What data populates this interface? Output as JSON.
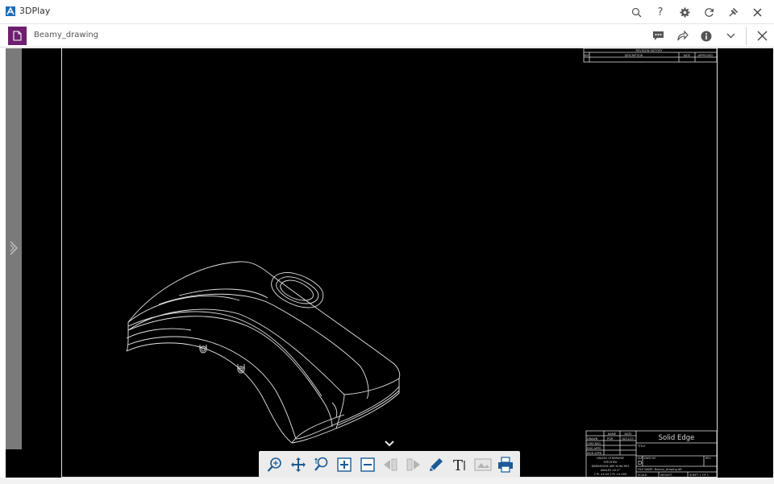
{
  "app": {
    "title": "3DPlay",
    "icons": [
      "search-icon",
      "help-icon",
      "settings-icon",
      "refresh-icon",
      "pin-icon",
      "close-icon"
    ],
    "help_glyph": "?"
  },
  "document": {
    "title": "Beamy_drawing",
    "icons": [
      "comment-icon",
      "share-icon",
      "info-icon",
      "chevron-down-icon",
      "close-icon"
    ],
    "accent": "#6e1f6e"
  },
  "title_block": {
    "brand": "Solid Edge",
    "revision_history": "REVISION HISTORY",
    "rev_headers": [
      "REV",
      "DESCRIPTION",
      "DATE",
      "APPROVED"
    ],
    "name_header": "NAME",
    "date_header": "DATE",
    "drawn": "DRAWN",
    "drawn_by": "PDR",
    "drawn_date": "10/11/23",
    "checked": "CHECKED",
    "eng_appr": "ENG APPR",
    "mgr_appr": "MGR APPR",
    "tolerances": [
      "UNLESS OTHERWISE",
      "SPECIFIED",
      "DIMENSIONS ARE IN INCHES",
      "ANGLES ±X.X°",
      "2 PL ±X.XX  3 PL ±X.XXX"
    ],
    "title_label": "TITLE",
    "size_label": "SIZE",
    "size_value": "D",
    "dwg_no_label": "DWG NO",
    "rev_label": "REV",
    "file_name": "FILE NAME: Beamy_drawing.dft",
    "scale_label": "SCALE:",
    "weight_label": "WEIGHT:",
    "sheet_label": "SHEET 1 OF 1"
  },
  "viewer": {
    "side_panel_toggle": "chevron-right-icon",
    "toolbar_toggle_glyph": "⌄"
  },
  "toolbar": {
    "tools": [
      {
        "name": "zoom-area-icon",
        "enabled": true
      },
      {
        "name": "pan-icon",
        "enabled": true
      },
      {
        "name": "zoom-icon",
        "enabled": true
      },
      {
        "name": "zoom-in-icon",
        "enabled": true
      },
      {
        "name": "zoom-out-icon",
        "enabled": true
      },
      {
        "name": "previous-sheet-icon",
        "enabled": false
      },
      {
        "name": "next-sheet-icon",
        "enabled": false
      },
      {
        "name": "markup-pen-icon",
        "enabled": true
      },
      {
        "name": "text-tool-icon",
        "enabled": true
      },
      {
        "name": "image-icon",
        "enabled": false
      },
      {
        "name": "print-icon",
        "enabled": true
      }
    ],
    "text_tool_glyph": "T"
  }
}
